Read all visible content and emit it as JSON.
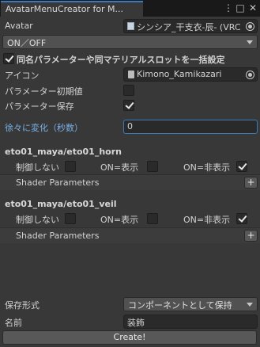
{
  "window": {
    "tab_title": "AvatarMenuCreator for M..."
  },
  "avatar": {
    "label": "Avatar",
    "value": "シンシア_干支衣-辰- (VRC"
  },
  "mode": {
    "value": "ON／OFF"
  },
  "same_name_param": {
    "label": "同名パラメーターや同マテリアルスロットを一括設定",
    "checked": true
  },
  "icon": {
    "label": "アイコン",
    "value": "Kimono_Kamikazari"
  },
  "param_default": {
    "label": "パラメーター初期値",
    "checked": false
  },
  "param_saved": {
    "label": "パラメーター保存",
    "checked": true
  },
  "transition": {
    "label": "徐々に変化（秒数）",
    "value": "0"
  },
  "objects": [
    {
      "path": "eto01_maya/eto01_horn",
      "uncontrolled_label": "制御しない",
      "on_show_label": "ON=表示",
      "on_hide_label": "ON=非表示",
      "uncontrolled": false,
      "on_show": false,
      "on_hide": true,
      "shader_label": "Shader Parameters",
      "add_label": "+"
    },
    {
      "path": "eto01_maya/eto01_veil",
      "uncontrolled_label": "制御しない",
      "on_show_label": "ON=表示",
      "on_hide_label": "ON=非表示",
      "uncontrolled": false,
      "on_show": false,
      "on_hide": true,
      "shader_label": "Shader Parameters",
      "add_label": "+"
    }
  ],
  "save_format": {
    "label": "保存形式",
    "value": "コンポーネントとして保持"
  },
  "name": {
    "label": "名前",
    "value": "装飾"
  },
  "create_label": "Create!"
}
